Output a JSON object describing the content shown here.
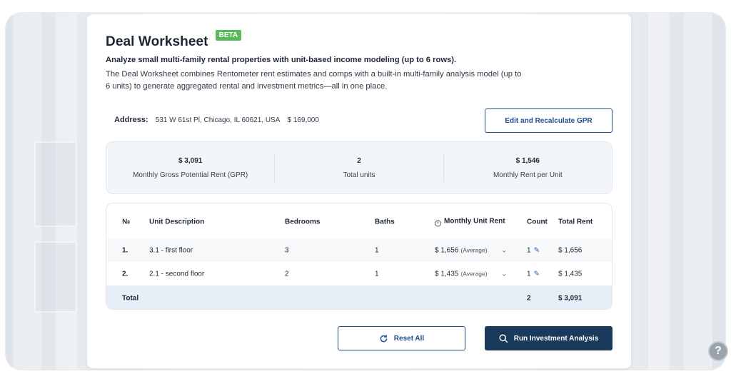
{
  "page": {
    "title": "Deal Worksheet",
    "badge": "BETA",
    "intro_bold": "Analyze small multi-family rental properties with unit-based income modeling (up to 6 rows).",
    "intro": "The Deal Worksheet combines Rentometer rent estimates and comps with a built-in multi-family analysis model (up to 6 units) to generate aggregated rental and investment metrics—all in one place."
  },
  "address": {
    "label": "Address:",
    "value": "531 W 61st Pl, Chicago, IL 60621, USA",
    "price": "$ 169,000"
  },
  "actions": {
    "edit_recalc": "Edit and Recalculate GPR",
    "reset": "Reset All",
    "run": "Run Investment Analysis"
  },
  "stats": [
    {
      "value": "$ 3,091",
      "label": "Monthly Gross Potential Rent (GPR)"
    },
    {
      "value": "2",
      "label": "Total units"
    },
    {
      "value": "$ 1,546",
      "label": "Monthly Rent per Unit"
    }
  ],
  "table": {
    "headers": {
      "no": "№",
      "desc": "Unit Description",
      "bedrooms": "Bedrooms",
      "baths": "Baths",
      "monthly_rent": "Monthly Unit Rent",
      "count": "Count",
      "total_rent": "Total Rent"
    },
    "rows": [
      {
        "no": "1.",
        "desc": "3.1 - first floor",
        "bedrooms": "3",
        "baths": "1",
        "rent": "$ 1,656",
        "rent_note": "(Average)",
        "count": "1",
        "total": "$ 1,656"
      },
      {
        "no": "2.",
        "desc": "2.1 - second floor",
        "bedrooms": "2",
        "baths": "1",
        "rent": "$ 1,435",
        "rent_note": "(Average)",
        "count": "1",
        "total": "$ 1,435"
      }
    ],
    "total": {
      "label": "Total",
      "count": "2",
      "total": "$ 3,091"
    }
  },
  "icons": {
    "info": "info-icon",
    "chevron": "chevron-down-icon",
    "edit": "pencil-icon",
    "reset": "refresh-icon",
    "search": "search-icon",
    "help": "help-icon"
  },
  "colors": {
    "primary": "#1a3a5c",
    "link": "#1e4e8c",
    "beta": "#5cb85c",
    "total_row": "#e6eff7"
  }
}
